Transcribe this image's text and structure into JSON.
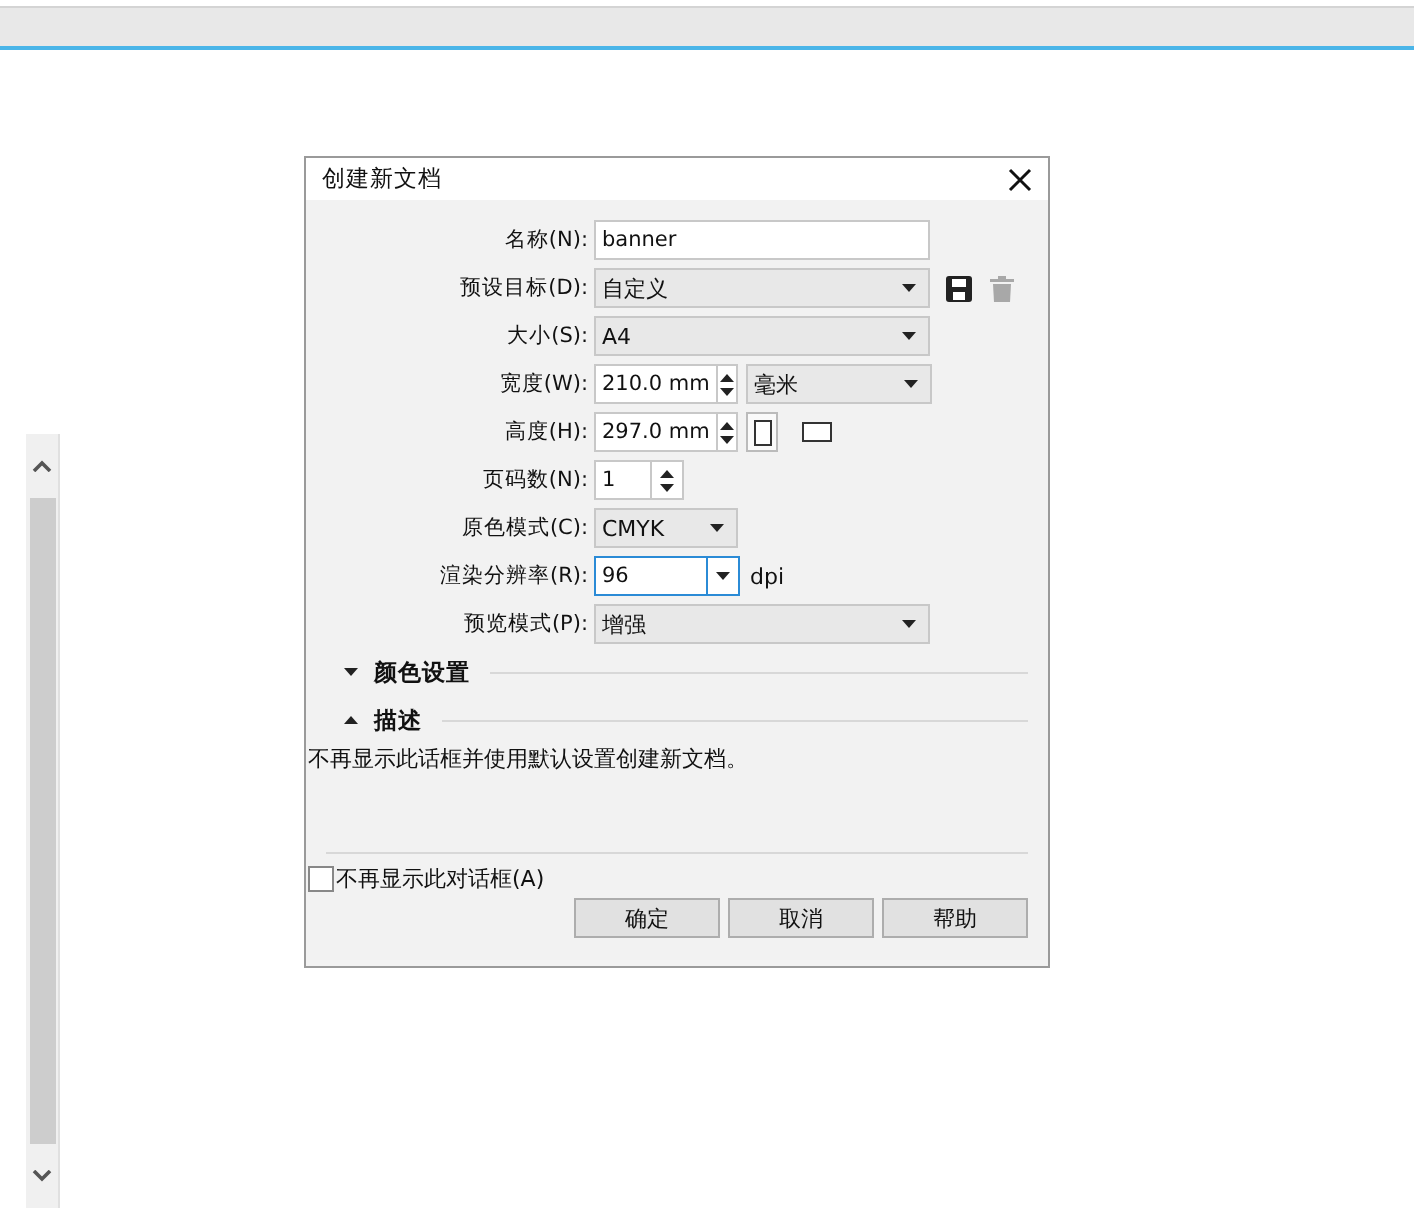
{
  "dialog": {
    "title": "创建新文档",
    "fields": [
      {
        "kind": "text",
        "label": "名称(N):",
        "value": "banner"
      },
      {
        "kind": "preset",
        "label": "预设目标(D):",
        "value": "自定义",
        "delete_disabled": true
      },
      {
        "kind": "dropdown",
        "label": "大小(S):",
        "value": "A4"
      },
      {
        "kind": "spin_unit",
        "label": "宽度(W):",
        "value": "210.0 mm",
        "unit": "毫米"
      },
      {
        "kind": "spin_orient",
        "label": "高度(H):",
        "value": "297.0 mm",
        "portrait_selected": true
      },
      {
        "kind": "spin",
        "label": "页码数(N):",
        "value": "1"
      },
      {
        "kind": "dropdown_short",
        "label": "原色模式(C):",
        "value": "CMYK"
      },
      {
        "kind": "combo",
        "label": "渲染分辨率(R):",
        "value": "96",
        "suffix": "dpi",
        "focused": true
      },
      {
        "kind": "dropdown",
        "label": "预览模式(P):",
        "value": "增强"
      }
    ],
    "sections": [
      {
        "title": "颜色设置",
        "expanded": false
      },
      {
        "title": "描述",
        "expanded": true,
        "text": "不再显示此话框并使用默认设置创建新文档。"
      }
    ],
    "checkbox": {
      "label": "不再显示此对话框(A)",
      "checked": false
    },
    "buttons": [
      "确定",
      "取消",
      "帮助"
    ]
  }
}
